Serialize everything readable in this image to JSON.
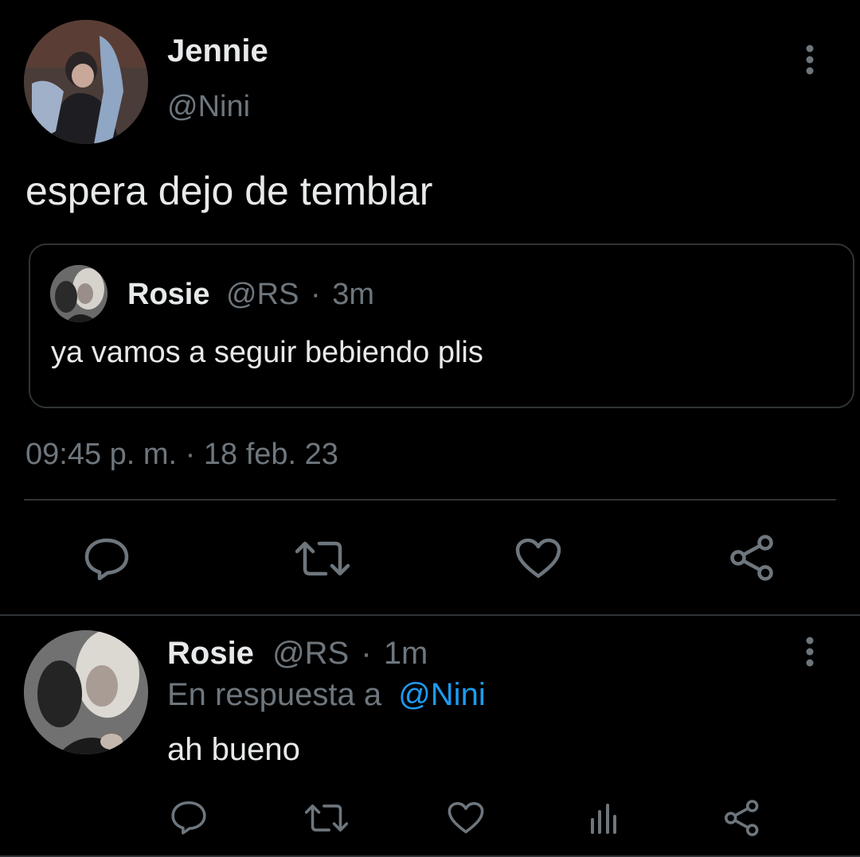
{
  "main_tweet": {
    "author_name": "Jennie",
    "author_handle": "@Nini",
    "text": "espera dejo de temblar",
    "quoted": {
      "author_name": "Rosie",
      "author_handle": "@RS",
      "separator": "·",
      "time": "3m",
      "text": "ya vamos a seguir bebiendo plis"
    },
    "timestamp": "09:45 p. m. · 18 feb. 23",
    "actions": [
      "reply-icon",
      "retweet-icon",
      "like-icon",
      "share-icon"
    ]
  },
  "reply_tweet": {
    "author_name": "Rosie",
    "author_handle": "@RS",
    "separator": "·",
    "time": "1m",
    "reply_prefix": "En respuesta a",
    "reply_to": "@Nini",
    "text": "ah bueno",
    "actions": [
      "reply-icon",
      "retweet-icon",
      "like-icon",
      "analytics-icon",
      "share-icon"
    ]
  },
  "colors": {
    "background": "#000000",
    "text": "#e7e9ea",
    "muted": "#6e767d",
    "link": "#1d9bf0",
    "border": "#2f3336"
  }
}
